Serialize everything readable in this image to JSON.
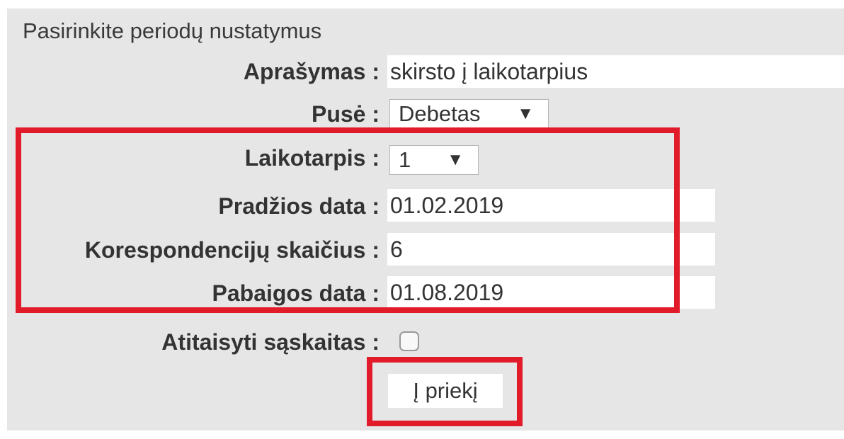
{
  "form": {
    "title": "Pasirinkite periodų nustatymus",
    "description_label": "Aprašymas :",
    "description_value": "skirsto į laikotarpius",
    "side_label": "Pusė :",
    "side_value": "Debetas",
    "period_label": "Laikotarpis :",
    "period_value": "1",
    "start_date_label": "Pradžios data :",
    "start_date_value": "01.02.2019",
    "count_label": "Korespondencijų skaičius :",
    "count_value": "6",
    "end_date_label": "Pabaigos data :",
    "end_date_value": "01.08.2019",
    "fix_invoices_label": "Atitaisyti sąskaitas :",
    "fix_invoices_checked": false,
    "submit_label": "Į priekį"
  },
  "icons": {
    "dropdown_arrow": "▼"
  },
  "colors": {
    "highlight": "#e21b2b",
    "panel_bg": "#e6e6e6"
  }
}
